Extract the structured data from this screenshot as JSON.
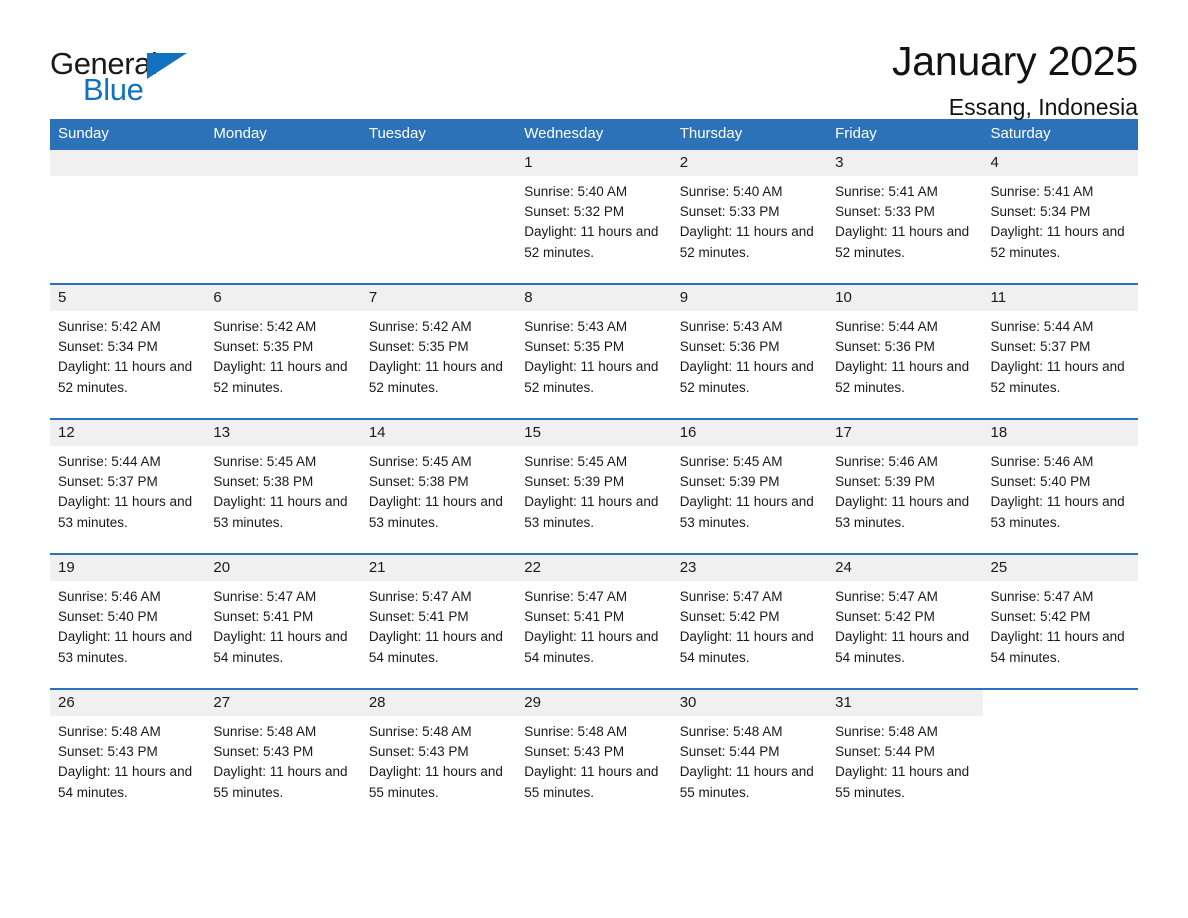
{
  "brand": {
    "name_part1": "General",
    "name_part2": "Blue",
    "accent_color": "#1272c0",
    "logo_icon": "triangle-flag-icon"
  },
  "header": {
    "title": "January 2025",
    "location": "Essang, Indonesia"
  },
  "calendar": {
    "header_bg": "#2b72b8",
    "daynum_bg": "#f0f0f0",
    "weekday_headers": [
      "Sunday",
      "Monday",
      "Tuesday",
      "Wednesday",
      "Thursday",
      "Friday",
      "Saturday"
    ],
    "weeks": [
      [
        {
          "day": "",
          "empty": true
        },
        {
          "day": "",
          "empty": true
        },
        {
          "day": "",
          "empty": true
        },
        {
          "day": "1",
          "sunrise": "Sunrise: 5:40 AM",
          "sunset": "Sunset: 5:32 PM",
          "daylight": "Daylight: 11 hours and 52 minutes."
        },
        {
          "day": "2",
          "sunrise": "Sunrise: 5:40 AM",
          "sunset": "Sunset: 5:33 PM",
          "daylight": "Daylight: 11 hours and 52 minutes."
        },
        {
          "day": "3",
          "sunrise": "Sunrise: 5:41 AM",
          "sunset": "Sunset: 5:33 PM",
          "daylight": "Daylight: 11 hours and 52 minutes."
        },
        {
          "day": "4",
          "sunrise": "Sunrise: 5:41 AM",
          "sunset": "Sunset: 5:34 PM",
          "daylight": "Daylight: 11 hours and 52 minutes."
        }
      ],
      [
        {
          "day": "5",
          "sunrise": "Sunrise: 5:42 AM",
          "sunset": "Sunset: 5:34 PM",
          "daylight": "Daylight: 11 hours and 52 minutes."
        },
        {
          "day": "6",
          "sunrise": "Sunrise: 5:42 AM",
          "sunset": "Sunset: 5:35 PM",
          "daylight": "Daylight: 11 hours and 52 minutes."
        },
        {
          "day": "7",
          "sunrise": "Sunrise: 5:42 AM",
          "sunset": "Sunset: 5:35 PM",
          "daylight": "Daylight: 11 hours and 52 minutes."
        },
        {
          "day": "8",
          "sunrise": "Sunrise: 5:43 AM",
          "sunset": "Sunset: 5:35 PM",
          "daylight": "Daylight: 11 hours and 52 minutes."
        },
        {
          "day": "9",
          "sunrise": "Sunrise: 5:43 AM",
          "sunset": "Sunset: 5:36 PM",
          "daylight": "Daylight: 11 hours and 52 minutes."
        },
        {
          "day": "10",
          "sunrise": "Sunrise: 5:44 AM",
          "sunset": "Sunset: 5:36 PM",
          "daylight": "Daylight: 11 hours and 52 minutes."
        },
        {
          "day": "11",
          "sunrise": "Sunrise: 5:44 AM",
          "sunset": "Sunset: 5:37 PM",
          "daylight": "Daylight: 11 hours and 52 minutes."
        }
      ],
      [
        {
          "day": "12",
          "sunrise": "Sunrise: 5:44 AM",
          "sunset": "Sunset: 5:37 PM",
          "daylight": "Daylight: 11 hours and 53 minutes."
        },
        {
          "day": "13",
          "sunrise": "Sunrise: 5:45 AM",
          "sunset": "Sunset: 5:38 PM",
          "daylight": "Daylight: 11 hours and 53 minutes."
        },
        {
          "day": "14",
          "sunrise": "Sunrise: 5:45 AM",
          "sunset": "Sunset: 5:38 PM",
          "daylight": "Daylight: 11 hours and 53 minutes."
        },
        {
          "day": "15",
          "sunrise": "Sunrise: 5:45 AM",
          "sunset": "Sunset: 5:39 PM",
          "daylight": "Daylight: 11 hours and 53 minutes."
        },
        {
          "day": "16",
          "sunrise": "Sunrise: 5:45 AM",
          "sunset": "Sunset: 5:39 PM",
          "daylight": "Daylight: 11 hours and 53 minutes."
        },
        {
          "day": "17",
          "sunrise": "Sunrise: 5:46 AM",
          "sunset": "Sunset: 5:39 PM",
          "daylight": "Daylight: 11 hours and 53 minutes."
        },
        {
          "day": "18",
          "sunrise": "Sunrise: 5:46 AM",
          "sunset": "Sunset: 5:40 PM",
          "daylight": "Daylight: 11 hours and 53 minutes."
        }
      ],
      [
        {
          "day": "19",
          "sunrise": "Sunrise: 5:46 AM",
          "sunset": "Sunset: 5:40 PM",
          "daylight": "Daylight: 11 hours and 53 minutes."
        },
        {
          "day": "20",
          "sunrise": "Sunrise: 5:47 AM",
          "sunset": "Sunset: 5:41 PM",
          "daylight": "Daylight: 11 hours and 54 minutes."
        },
        {
          "day": "21",
          "sunrise": "Sunrise: 5:47 AM",
          "sunset": "Sunset: 5:41 PM",
          "daylight": "Daylight: 11 hours and 54 minutes."
        },
        {
          "day": "22",
          "sunrise": "Sunrise: 5:47 AM",
          "sunset": "Sunset: 5:41 PM",
          "daylight": "Daylight: 11 hours and 54 minutes."
        },
        {
          "day": "23",
          "sunrise": "Sunrise: 5:47 AM",
          "sunset": "Sunset: 5:42 PM",
          "daylight": "Daylight: 11 hours and 54 minutes."
        },
        {
          "day": "24",
          "sunrise": "Sunrise: 5:47 AM",
          "sunset": "Sunset: 5:42 PM",
          "daylight": "Daylight: 11 hours and 54 minutes."
        },
        {
          "day": "25",
          "sunrise": "Sunrise: 5:47 AM",
          "sunset": "Sunset: 5:42 PM",
          "daylight": "Daylight: 11 hours and 54 minutes."
        }
      ],
      [
        {
          "day": "26",
          "sunrise": "Sunrise: 5:48 AM",
          "sunset": "Sunset: 5:43 PM",
          "daylight": "Daylight: 11 hours and 54 minutes."
        },
        {
          "day": "27",
          "sunrise": "Sunrise: 5:48 AM",
          "sunset": "Sunset: 5:43 PM",
          "daylight": "Daylight: 11 hours and 55 minutes."
        },
        {
          "day": "28",
          "sunrise": "Sunrise: 5:48 AM",
          "sunset": "Sunset: 5:43 PM",
          "daylight": "Daylight: 11 hours and 55 minutes."
        },
        {
          "day": "29",
          "sunrise": "Sunrise: 5:48 AM",
          "sunset": "Sunset: 5:43 PM",
          "daylight": "Daylight: 11 hours and 55 minutes."
        },
        {
          "day": "30",
          "sunrise": "Sunrise: 5:48 AM",
          "sunset": "Sunset: 5:44 PM",
          "daylight": "Daylight: 11 hours and 55 minutes."
        },
        {
          "day": "31",
          "sunrise": "Sunrise: 5:48 AM",
          "sunset": "Sunset: 5:44 PM",
          "daylight": "Daylight: 11 hours and 55 minutes."
        },
        {
          "day": "",
          "empty": true,
          "blank": true
        }
      ]
    ]
  }
}
